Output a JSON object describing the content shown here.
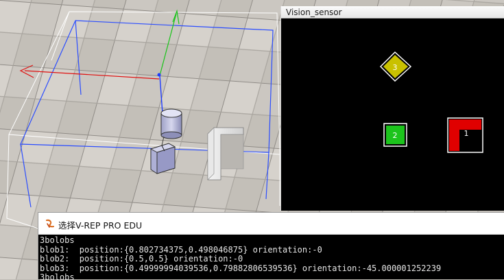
{
  "vision_sensor": {
    "title": "Vision_sensor",
    "blobs": [
      {
        "label": "3",
        "color": "#c9c100",
        "shape": "rotated-square"
      },
      {
        "label": "2",
        "color": "#1cc41c",
        "shape": "square"
      },
      {
        "label": "1",
        "color": "#e00000",
        "shape": "l-shape"
      }
    ]
  },
  "console": {
    "title": "选择V-REP PRO EDU",
    "lines": [
      "3bolobs",
      "blob1:  position:{0.802734375,0.498046875} orientation:-0",
      "blob2:  position:{0.5,0.5} orientation:-0",
      "blob3:  position:{0.49999994039536,0.79882806539536} orientation:-45.000001252239",
      "3bolobs"
    ]
  },
  "colors": {
    "console_bg": "#000000",
    "console_text": "#e6e6e6",
    "sensor_bg": "#000000",
    "x_axis": "#e01010",
    "y_axis": "#18c418",
    "z_axis": "#1f3cff",
    "bounding_box_blue": "#2b4dff"
  }
}
